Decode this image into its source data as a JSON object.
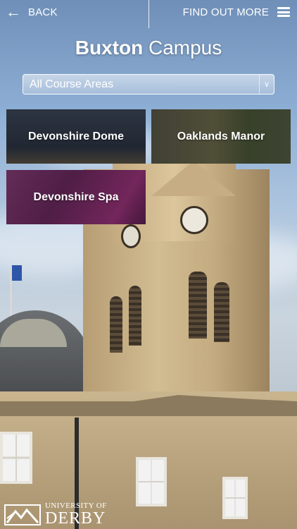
{
  "topbar": {
    "back_icon": "arrow-left-icon",
    "back_label": "BACK",
    "more_label": "FIND OUT MORE",
    "menu_icon": "hamburger-menu-icon"
  },
  "title": {
    "bold": "Buxton",
    "light": "Campus"
  },
  "filter": {
    "selected": "All Course Areas"
  },
  "tiles": [
    {
      "label": "Devonshire Dome"
    },
    {
      "label": "Oaklands Manor"
    },
    {
      "label": "Devonshire Spa"
    }
  ],
  "logo": {
    "top": "UNIVERSITY OF",
    "bottom": "DERBY"
  },
  "colors": {
    "text": "#ffffff",
    "spa_tile": "#8a3f7a"
  }
}
